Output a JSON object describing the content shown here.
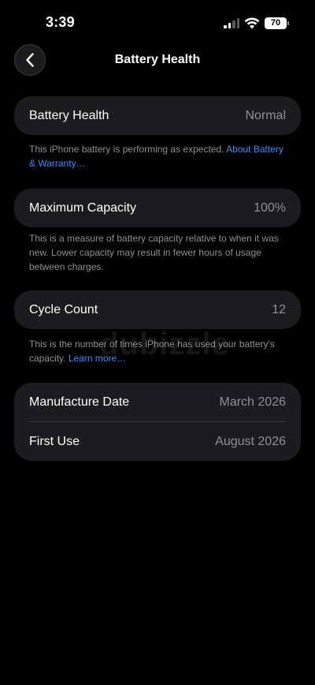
{
  "status_bar": {
    "time": "3:39",
    "battery_level": "70",
    "signal_bars_active": 2,
    "signal_bars_total": 4
  },
  "nav": {
    "title": "Battery Health",
    "back_icon": "chevron-left-icon"
  },
  "battery_health": {
    "label": "Battery Health",
    "value": "Normal",
    "footer_text": "This iPhone battery is performing as expected.",
    "footer_link": "About Battery & Warranty…"
  },
  "maximum_capacity": {
    "label": "Maximum Capacity",
    "value": "100%",
    "footer_text": "This is a measure of battery capacity relative to when it was new. Lower capacity may result in fewer hours of usage between charges."
  },
  "cycle_count": {
    "label": "Cycle Count",
    "value": "12",
    "footer_text": "This is the number of times iPhone has used your battery's capacity.",
    "footer_link": "Learn more…"
  },
  "dates": {
    "manufacture_label": "Manufacture Date",
    "manufacture_value": "March 2026",
    "first_use_label": "First Use",
    "first_use_value": "August 2026"
  },
  "watermark": "dubizzle",
  "colors": {
    "background": "#000000",
    "card": "#1c1c1e",
    "secondary_text": "#8e8e93",
    "link": "#3a8cff"
  }
}
